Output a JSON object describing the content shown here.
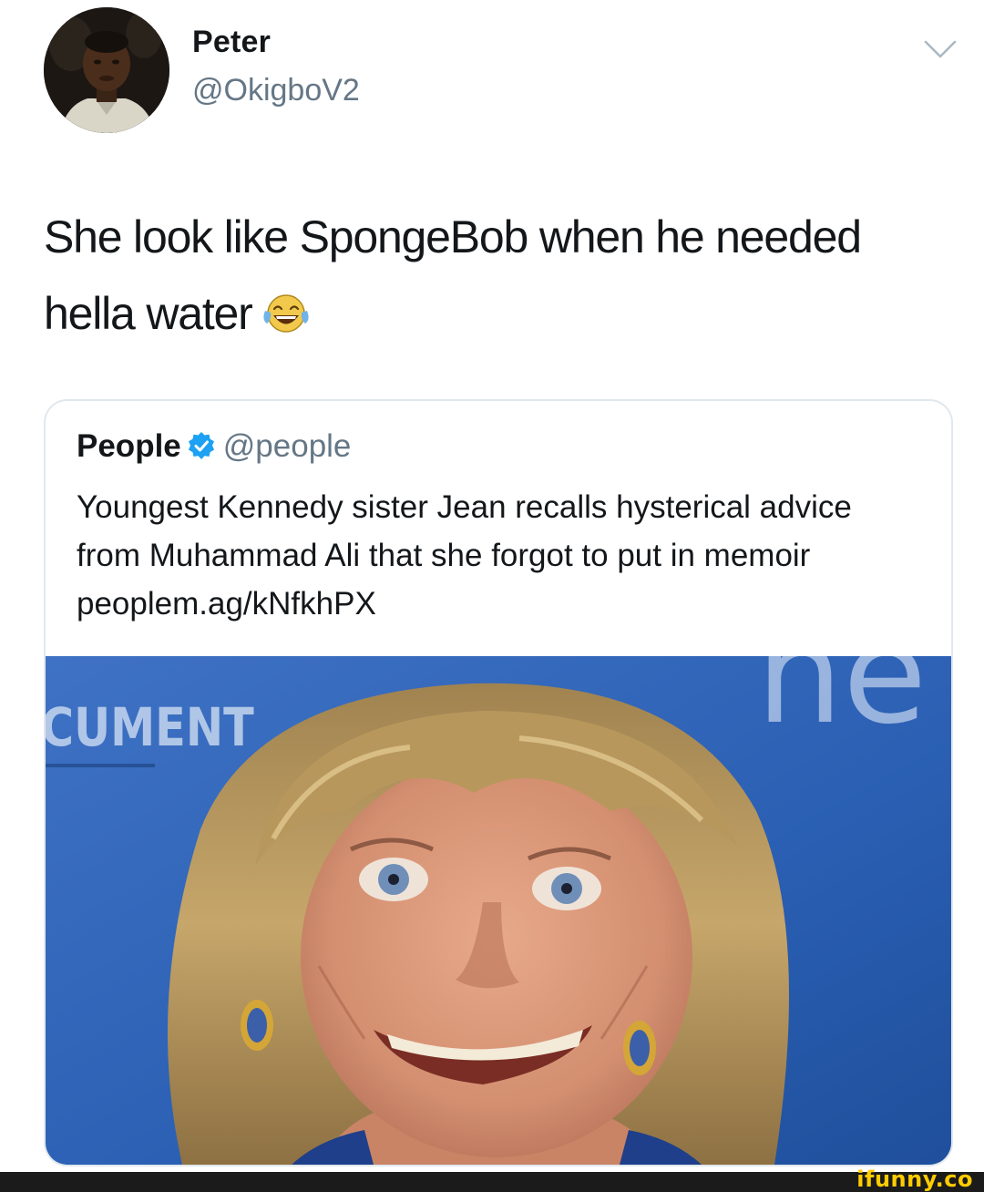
{
  "tweet": {
    "author_name": "Peter",
    "author_handle": "@OkigboV2",
    "text": "She look like SpongeBob when he needed hella water",
    "emoji": "face-with-tears-of-joy-icon"
  },
  "quoted_tweet": {
    "author_name": "People",
    "author_handle": "@people",
    "verified": true,
    "text": "Youngest Kennedy sister Jean recalls hysterical advice from Muhammad Ali that she forgot to put in memoir peoplem.ag/kNfkhPX",
    "image_backdrop_text_left": "CUMENT",
    "image_backdrop_text_right": "ne"
  },
  "watermark": {
    "text": "ifunny.co"
  },
  "colors": {
    "text": "#14171a",
    "secondary": "#657786",
    "verified": "#1da1f2",
    "card_border": "#e1e8ed",
    "photo_backdrop": "#2c62b8",
    "watermark": "#ffcc00"
  }
}
